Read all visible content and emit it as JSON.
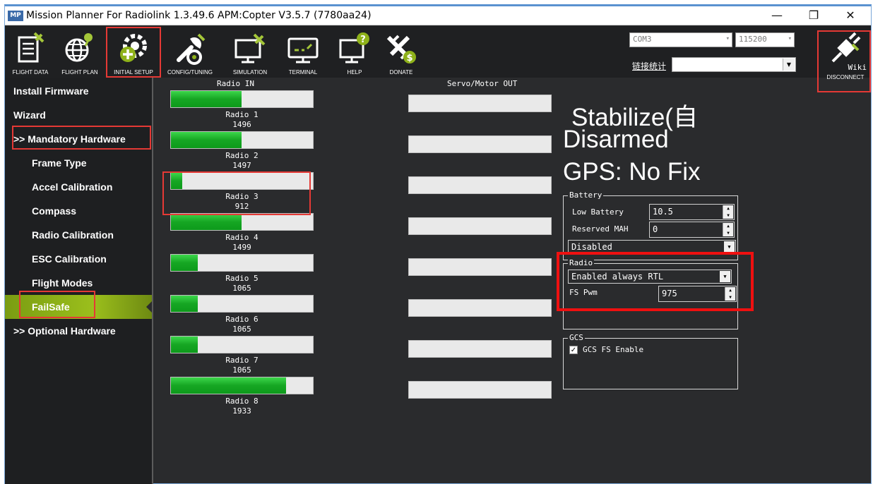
{
  "window": {
    "app_icon": "MP",
    "title": "Mission Planner For Radiolink 1.3.49.6 APM:Copter V3.5.7 (7780aa24)",
    "minimize": "—",
    "restore": "❐",
    "close": "✕"
  },
  "toolbar": {
    "buttons": [
      {
        "label": "FLIGHT DATA",
        "icon": "flight-data-icon"
      },
      {
        "label": "FLIGHT PLAN",
        "icon": "flight-plan-icon"
      },
      {
        "label": "INITIAL SETUP",
        "icon": "initial-setup-icon"
      },
      {
        "label": "CONFIG/TUNING",
        "icon": "config-tuning-icon"
      },
      {
        "label": "SIMULATION",
        "icon": "simulation-icon"
      },
      {
        "label": "TERMINAL",
        "icon": "terminal-icon"
      },
      {
        "label": "HELP",
        "icon": "help-icon"
      },
      {
        "label": "DONATE",
        "icon": "donate-icon"
      }
    ],
    "port": "COM3",
    "baud": "115200",
    "link_stats": "链接统计",
    "disconnect": "DISCONNECT",
    "wiki": "Wiki"
  },
  "sidebar": {
    "items": [
      {
        "label": "Install Firmware"
      },
      {
        "label": "Wizard"
      },
      {
        "label": ">> Mandatory Hardware"
      },
      {
        "label": "Frame Type"
      },
      {
        "label": "Accel Calibration"
      },
      {
        "label": "Compass"
      },
      {
        "label": "Radio Calibration"
      },
      {
        "label": "ESC Calibration"
      },
      {
        "label": "Flight Modes"
      },
      {
        "label": "FailSafe"
      },
      {
        "label": ">> Optional Hardware"
      }
    ],
    "active": "FailSafe"
  },
  "radio_in": {
    "title": "Radio IN",
    "range": [
      800,
      2200
    ],
    "channels": [
      {
        "name": "Radio 1",
        "value": "1496"
      },
      {
        "name": "Radio 2",
        "value": "1497"
      },
      {
        "name": "Radio 3",
        "value": "912"
      },
      {
        "name": "Radio 4",
        "value": "1499"
      },
      {
        "name": "Radio 5",
        "value": "1065"
      },
      {
        "name": "Radio 6",
        "value": "1065"
      },
      {
        "name": "Radio 7",
        "value": "1065"
      },
      {
        "name": "Radio 8",
        "value": "1933"
      }
    ]
  },
  "servo_out": {
    "title": "Servo/Motor OUT",
    "bars": 8
  },
  "status": {
    "mode": "Stabilize(自",
    "armed": "Disarmed",
    "gps": "GPS: No Fix"
  },
  "battery": {
    "title": "Battery",
    "low_battery_label": "Low Battery",
    "low_battery_value": "10.5",
    "reserved_mah_label": "Reserved MAH",
    "reserved_mah_value": "0",
    "action": "Disabled"
  },
  "radio_fs": {
    "title": "Radio",
    "action": "Enabled always RTL",
    "fs_pwm_label": "FS Pwm",
    "fs_pwm_value": "975"
  },
  "gcs": {
    "title": "GCS",
    "fs_enable_label": "GCS FS Enable",
    "fs_enable_checked": true
  },
  "colors": {
    "highlight": "#e53935",
    "bar_fill": "#16a623",
    "active_item": "#8fb21a"
  }
}
